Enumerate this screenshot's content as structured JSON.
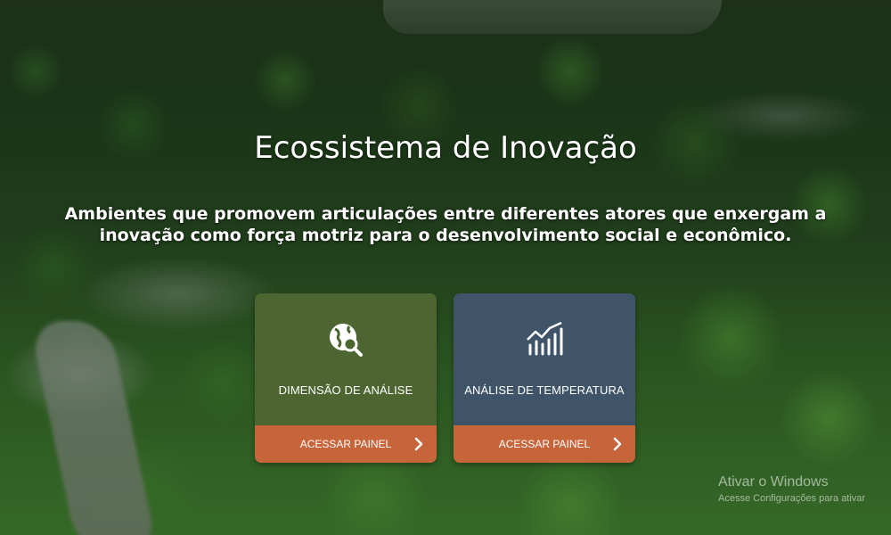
{
  "hero": {
    "title": "Ecossistema de Inovação",
    "subtitle_line1": "Ambientes que promovem articulações entre diferentes atores que enxergam a",
    "subtitle_line2": "inovação como força motriz para o desenvolvimento social e econômico."
  },
  "cards": [
    {
      "title": "DIMENSÃO DE ANÁLISE",
      "icon": "globe-search-icon",
      "cta_label": "ACESSAR PAINEL",
      "color": "#4d6530"
    },
    {
      "title": "ANÁLISE DE TEMPERATURA",
      "icon": "chart-trend-icon",
      "cta_label": "ACESSAR PAINEL",
      "color": "#3f5469"
    }
  ],
  "cta_color": "#c6643a",
  "watermark": {
    "title": "Ativar o Windows",
    "subtitle": "Acesse Configurações para ativar"
  }
}
